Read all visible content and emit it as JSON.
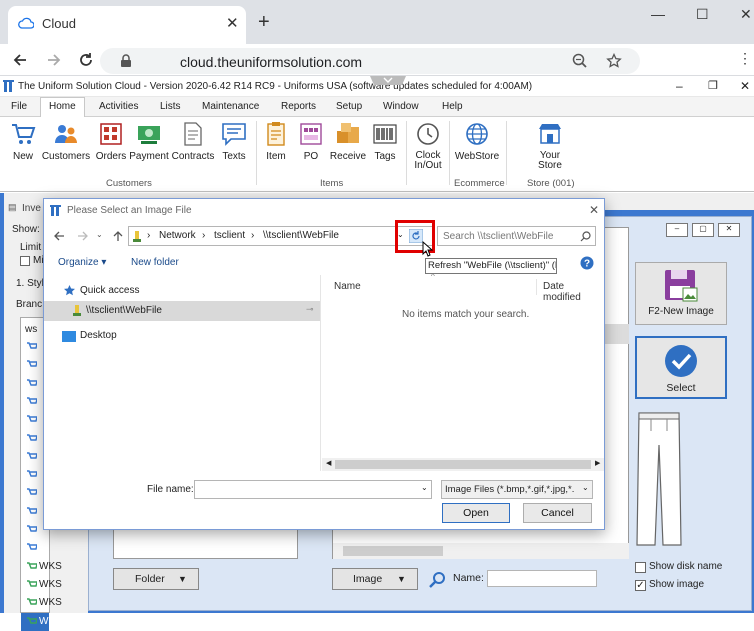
{
  "browser": {
    "tab_title": "Cloud",
    "tab_close": "✕",
    "new_tab": "+",
    "url": "cloud.theuniformsolution.com",
    "window_controls": [
      "—",
      "☐",
      "✕"
    ]
  },
  "app": {
    "title": "The Uniform Solution Cloud - Version 2020-6.42 R14 RC9 - Uniforms USA (software updates scheduled for  4:00AM)",
    "menu": [
      "File",
      "Home",
      "Activities",
      "Lists",
      "Maintenance",
      "Reports",
      "Setup",
      "Window",
      "Help"
    ],
    "ribbon": {
      "customers_buttons": [
        "New",
        "Customers",
        "Orders",
        "Payment",
        "Contracts",
        "Texts"
      ],
      "customers_group": "Customers",
      "items_buttons": [
        "Item",
        "PO",
        "Receive",
        "Tags"
      ],
      "items_group": "Items",
      "clock_label": "Clock In/Out",
      "webstore_label": "WebStore",
      "ecommerce_group": "Ecommerce",
      "store_label": "Your Store",
      "store_group": "Store (001)"
    }
  },
  "background_window": {
    "title_fragment": "Inve",
    "show_label": "Show:",
    "limit_label": "Limit",
    "mi_label": "Mi",
    "style_label": "1. Styl",
    "brand_label": "Branc",
    "ws_label": "ws",
    "list_rows": [
      "",
      "",
      "",
      "",
      "",
      "",
      "",
      "",
      "",
      "",
      "",
      "",
      "WKS",
      "WKS",
      "WKS",
      "WKS"
    ],
    "folder_button": "Folder",
    "image_button": "Image",
    "name_label": "Name:",
    "new_image_button": "F2-New Image",
    "select_button": "Select",
    "show_disk_name": "Show disk name",
    "show_image": "Show image",
    "show_disk_name_checked": false,
    "show_image_checked": true
  },
  "dialog": {
    "title": "Please Select an Image File",
    "breadcrumb": [
      "Network",
      "tsclient",
      "\\\\tsclient\\WebFile"
    ],
    "search_placeholder": "Search \\\\tsclient\\WebFile",
    "organize": "Organize ▾",
    "new_folder": "New folder",
    "tooltip": "Refresh \"WebFile (\\\\tsclient)\" (F5)",
    "nav": {
      "quick_access": "Quick access",
      "webfile": "\\\\tsclient\\WebFile",
      "desktop": "Desktop"
    },
    "columns": [
      "Name",
      "Date modified"
    ],
    "empty_message": "No items match your search.",
    "filename_label": "File name:",
    "filename_value": "",
    "filetype": "Image Files (*.bmp,*.gif,*.jpg,*.",
    "open_button": "Open",
    "cancel_button": "Cancel"
  },
  "colors": {
    "highlight_box": "#e00000",
    "select_button_bg": "#2f6fc2",
    "window_border": "#3c78d0"
  }
}
